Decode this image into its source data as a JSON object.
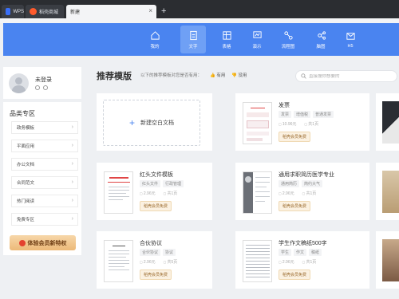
{
  "tabs": [
    {
      "label": "WPS"
    },
    {
      "label": "稻壳商城"
    },
    {
      "label": "新建"
    }
  ],
  "tab_close": "×",
  "tab_add": "+",
  "header": {
    "nav": [
      {
        "label": "我的",
        "icon": "home-icon"
      },
      {
        "label": "文字",
        "icon": "document-icon"
      },
      {
        "label": "表格",
        "icon": "table-icon"
      },
      {
        "label": "演示",
        "icon": "presentation-icon"
      },
      {
        "label": "流程图",
        "icon": "flowchart-icon"
      },
      {
        "label": "脑图",
        "icon": "mindmap-icon"
      },
      {
        "label": "H5",
        "icon": "h5-icon"
      }
    ],
    "active_index": 1
  },
  "user": {
    "login_text": "未登录"
  },
  "sidebar": {
    "title": "品类专区",
    "items": [
      "政务模板",
      "平面应用",
      "办公文档",
      "合同范文",
      "热门阅读",
      "免费专区"
    ],
    "arrow": "›",
    "promo_label": "体验会员新特权"
  },
  "main": {
    "title": "推荐模版",
    "format_hint": "以下的推荐模板对您是否有用：",
    "format_yes": "有用",
    "format_no": "没用",
    "search_placeholder": "直接搜你想要的",
    "blank_card": {
      "plus": "+",
      "label": "新建空白文档"
    },
    "templates": [
      {
        "title": "发票",
        "tags": [
          "发票",
          "增值税",
          "普通发票"
        ],
        "size": "10.96元",
        "pages": "共1页",
        "vip": "稻壳会员免费"
      },
      {
        "title": "红头文件模板",
        "tags": [
          "红头文件",
          "行政管理"
        ],
        "size": "2.96元",
        "pages": "共1页",
        "vip": "稻壳会员免费"
      },
      {
        "title": "通用求职简历医学专业",
        "tags": [
          "通用简历",
          "简约大气"
        ],
        "size": "2.96元",
        "pages": "共1页",
        "vip": "稻壳会员免费"
      },
      {
        "title": "合伙协议",
        "tags": [
          "合伙协议",
          "协议"
        ],
        "size": "2.96元",
        "pages": "共5页",
        "vip": "稻壳会员免费"
      },
      {
        "title": "学生作文稿纸500字",
        "tags": [
          "学生",
          "作文",
          "稿纸"
        ],
        "size": "2.96元",
        "pages": "共1页",
        "vip": "稻壳会员免费"
      }
    ]
  },
  "colors": {
    "header_blue": "#4a84f0",
    "active_nav": "#6fa0f5",
    "vip_gold": "#ecb978"
  }
}
